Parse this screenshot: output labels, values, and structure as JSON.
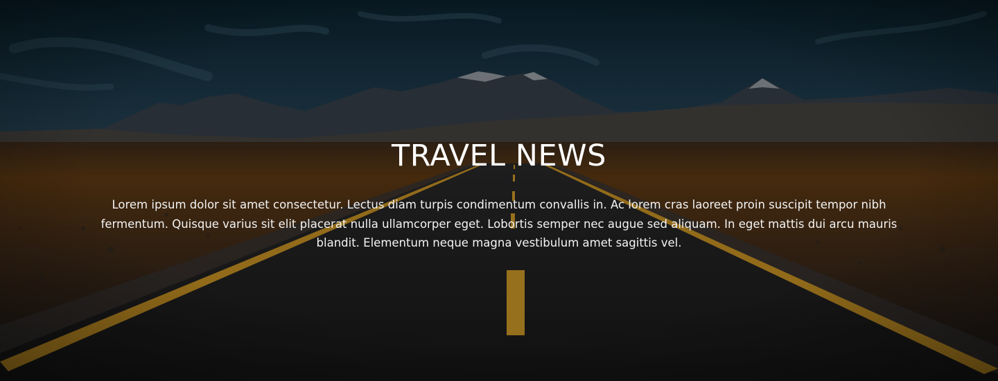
{
  "hero": {
    "title": "TRAVEL NEWS",
    "body": "Lorem ipsum dolor sit amet consectetur. Lectus diam turpis condimentum convallis in. Ac lorem cras laoreet proin suscipit tempor nibh fermentum. Quisque varius sit elit placerat nulla ullamcorper eget. Lobortis semper nec augue sed aliquam. In eget mattis dui arcu mauris blandit. Elementum neque magna vestibulum amet sagittis vel."
  },
  "colors": {
    "sky_top": "#0d2733",
    "sky_bottom": "#27465a",
    "mountains": "#3e4651",
    "snow": "#b9bdc4",
    "field": "#6a4318",
    "asphalt": "#1f1f20",
    "road_line": "#e7a92a",
    "text": "#ffffff"
  }
}
